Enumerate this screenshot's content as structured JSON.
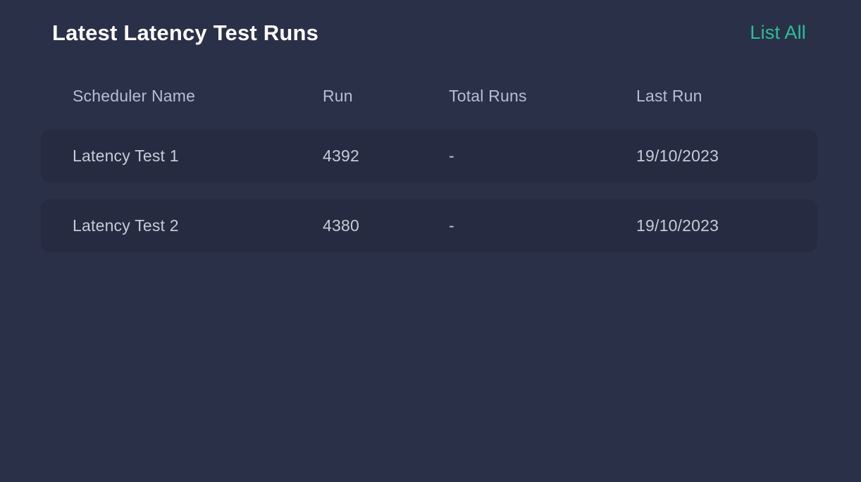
{
  "header": {
    "title": "Latest Latency Test Runs",
    "list_all_label": "List All"
  },
  "theme": {
    "page_background": "#2b3049",
    "row_background": "#262b41",
    "accent": "#28c196",
    "title_color": "#ffffff",
    "header_text_color": "#b7bdd2",
    "cell_text_color": "#c6cbd9"
  },
  "table": {
    "columns": [
      {
        "key": "scheduler_name",
        "label": "Scheduler Name"
      },
      {
        "key": "run",
        "label": "Run"
      },
      {
        "key": "total_runs",
        "label": "Total Runs"
      },
      {
        "key": "last_run",
        "label": "Last Run"
      }
    ],
    "rows": [
      {
        "scheduler_name": "Latency Test 1",
        "run": "4392",
        "total_runs": "-",
        "last_run": "19/10/2023"
      },
      {
        "scheduler_name": "Latency Test 2",
        "run": "4380",
        "total_runs": "-",
        "last_run": "19/10/2023"
      }
    ]
  }
}
